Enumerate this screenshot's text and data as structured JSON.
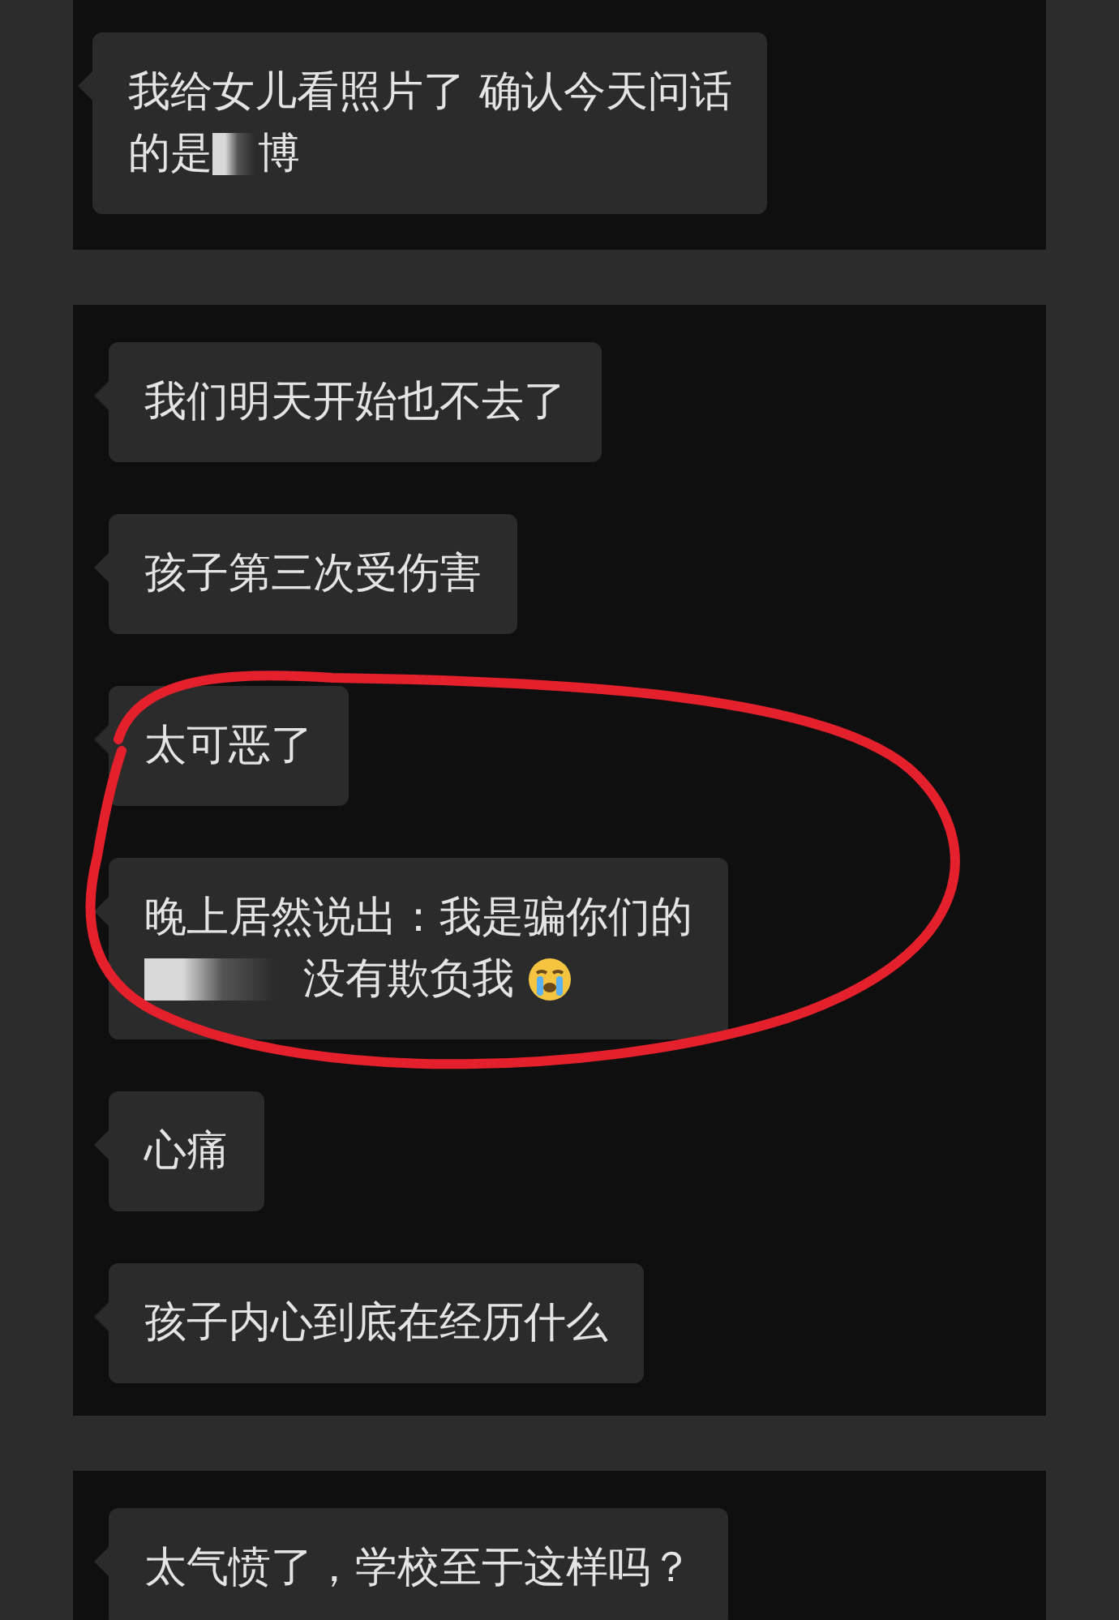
{
  "panels": [
    {
      "messages": [
        {
          "lines": [
            [
              {
                "kind": "text",
                "text": "我给女儿看照片了 确认今天问话"
              }
            ],
            [
              {
                "kind": "text",
                "text": "的是"
              },
              {
                "kind": "redacted"
              },
              {
                "kind": "text",
                "text": "博"
              }
            ]
          ]
        }
      ]
    },
    {
      "annotated": true,
      "messages": [
        {
          "lines": [
            [
              {
                "kind": "text",
                "text": "我们明天开始也不去了"
              }
            ]
          ]
        },
        {
          "lines": [
            [
              {
                "kind": "text",
                "text": "孩子第三次受伤害"
              }
            ]
          ]
        },
        {
          "lines": [
            [
              {
                "kind": "text",
                "text": "太可恶了"
              }
            ]
          ]
        },
        {
          "lines": [
            [
              {
                "kind": "text",
                "text": "晚上居然说出：我是骗你们的"
              }
            ],
            [
              {
                "kind": "redacted"
              },
              {
                "kind": "text",
                "text": "没有欺负我"
              },
              {
                "kind": "emoji"
              }
            ]
          ]
        },
        {
          "lines": [
            [
              {
                "kind": "text",
                "text": "心痛"
              }
            ]
          ]
        },
        {
          "lines": [
            [
              {
                "kind": "text",
                "text": "孩子内心到底在经历什么"
              }
            ]
          ]
        }
      ]
    },
    {
      "messages": [
        {
          "lines": [
            [
              {
                "kind": "text",
                "text": "太气愤了，学校至于这样吗？"
              }
            ]
          ]
        }
      ]
    }
  ]
}
